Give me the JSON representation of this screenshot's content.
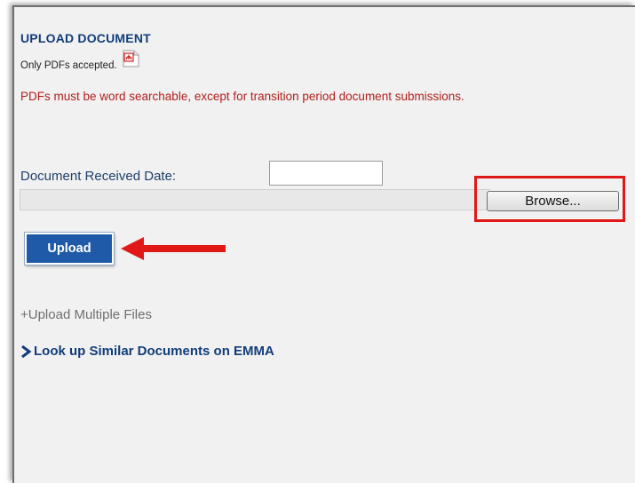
{
  "upload_section": {
    "title": "UPLOAD DOCUMENT",
    "pdf_note": "Only PDFs accepted.",
    "pdf_icon": "pdf-file-icon",
    "warning": "PDFs must be word searchable, except for transition period document submissions.",
    "warning_color": "#b0201c"
  },
  "form": {
    "date_label": "Document Received Date:",
    "date_value": "",
    "file_path_value": "",
    "browse_label": "Browse...",
    "upload_label": "Upload"
  },
  "links": {
    "upload_multiple": "+Upload Multiple Files",
    "emma_lookup": "Look up Similar Documents on EMMA",
    "emma_icon": "chevron-right-icon"
  },
  "annotations": {
    "highlight_color": "#e01818",
    "arrow_icon": "red-arrow-left-icon"
  },
  "colors": {
    "accent_blue": "#1e5aa7",
    "heading_blue": "#123d7a",
    "panel_bg": "#f1f1f1"
  }
}
